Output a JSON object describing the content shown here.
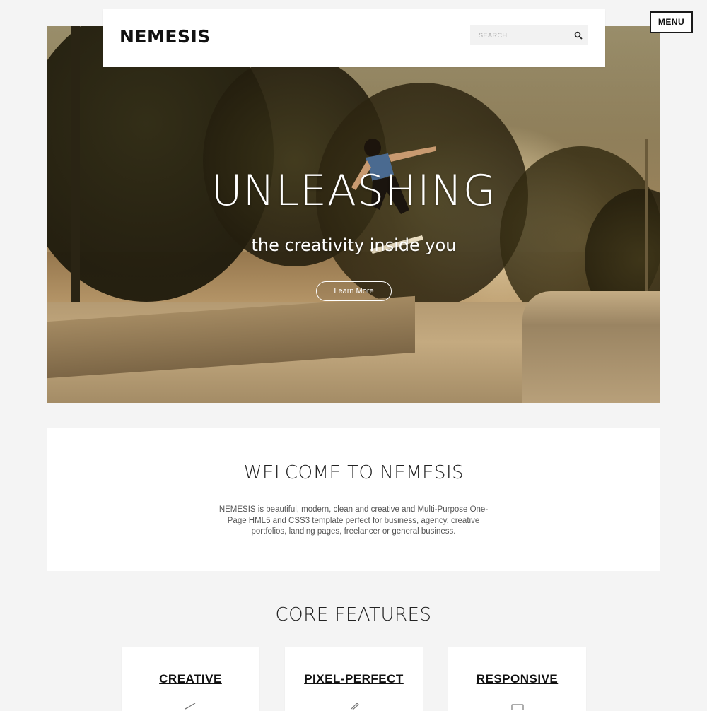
{
  "header": {
    "logo": "NEMESIS",
    "search_placeholder": "SEARCH",
    "search_icon": "search-icon"
  },
  "menu": {
    "label": "MENU"
  },
  "hero": {
    "title": "UNLEASHING",
    "subtitle": "the creativity inside you",
    "button_label": "Learn More"
  },
  "welcome": {
    "title": "WELCOME TO NEMESIS",
    "text": "NEMESIS is beautiful, modern, clean and creative and Multi-Purpose One-Page HML5 and CSS3 template perfect for business, agency, creative portfolios, landing pages, freelancer or general business."
  },
  "features": {
    "title": "CORE FEATURES",
    "items": [
      {
        "label": "CREATIVE",
        "icon": "brush-icon"
      },
      {
        "label": "PIXEL-PERFECT",
        "icon": "pencil-icon"
      },
      {
        "label": "RESPONSIVE",
        "icon": "monitor-icon"
      }
    ]
  },
  "colors": {
    "background": "#f4f4f4",
    "card": "#ffffff",
    "text": "#111111"
  }
}
